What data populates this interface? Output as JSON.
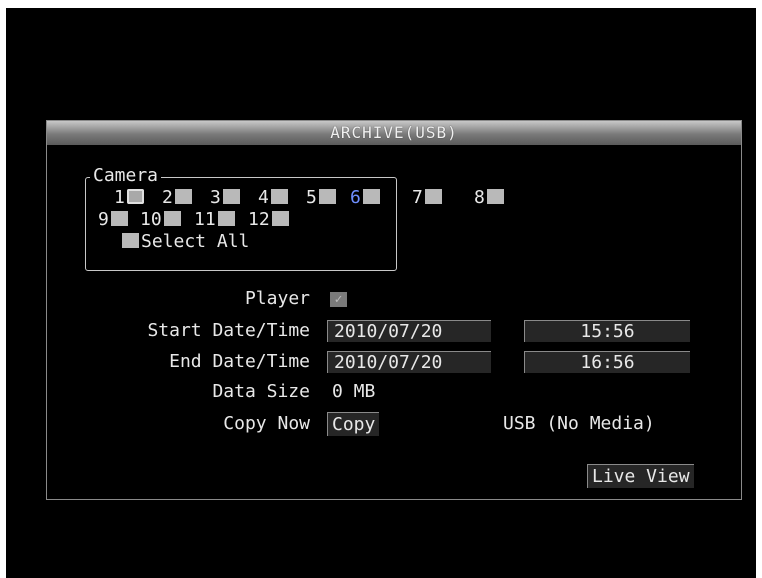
{
  "dialog": {
    "title": "ARCHIVE(USB)"
  },
  "camera": {
    "legend": "Camera",
    "items": [
      {
        "num": "1"
      },
      {
        "num": "2"
      },
      {
        "num": "3"
      },
      {
        "num": "4"
      },
      {
        "num": "5"
      },
      {
        "num": "6"
      },
      {
        "num": "7"
      },
      {
        "num": "8"
      },
      {
        "num": "9"
      },
      {
        "num": "10"
      },
      {
        "num": "11"
      },
      {
        "num": "12"
      }
    ],
    "select_all": "Select All"
  },
  "player": {
    "label": "Player",
    "checked": true,
    "check_glyph": "✓"
  },
  "start": {
    "label": "Start Date/Time",
    "date": "2010/07/20",
    "time": "15:56"
  },
  "end": {
    "label": "End Date/Time",
    "date": "2010/07/20",
    "time": "16:56"
  },
  "data_size": {
    "label": "Data Size",
    "value": "0 MB"
  },
  "copy_now": {
    "label": "Copy Now",
    "button": "Copy",
    "media_status": "USB (No Media)"
  },
  "live_view": {
    "label": "Live View"
  },
  "colors": {
    "background": "#000000",
    "text": "#e8e8e8",
    "checkbox": "#b9b9b9",
    "highlight_number": "#6f8fff"
  }
}
